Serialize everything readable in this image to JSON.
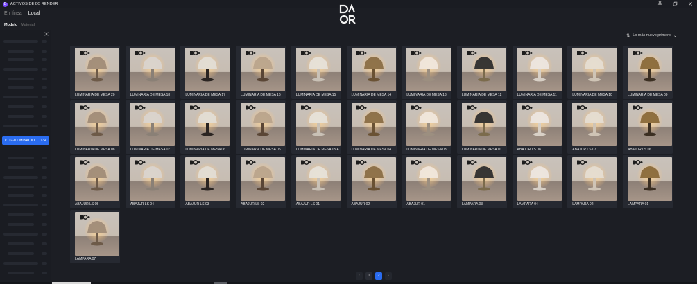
{
  "window": {
    "app_icon": "D",
    "title": "ACTIVOS DE D5 RENDER",
    "controls": [
      "pin-icon",
      "restore-icon",
      "close-icon"
    ]
  },
  "mode_tabs": [
    {
      "label": "En línea",
      "active": false
    },
    {
      "label": "Local",
      "active": true
    }
  ],
  "sub_tabs": [
    {
      "label": "Modelo",
      "active": true
    },
    {
      "label": "Material",
      "active": false
    }
  ],
  "sidebar": {
    "active_item": {
      "label": "07-ILUMINACIO...",
      "count": "134"
    }
  },
  "sort": {
    "label": "Lo más nuevo primero"
  },
  "colors": {
    "accent": "#2a6cf0",
    "background": "#1c1e24",
    "card": "#262931"
  },
  "assets": [
    {
      "label": "LUMINARIA DE MESA 20"
    },
    {
      "label": "LUMINARIA DE MESA 18"
    },
    {
      "label": "LUMINARIA DE MESA 17"
    },
    {
      "label": "LUMINARIA DE MESA 16"
    },
    {
      "label": "LUMINARIA DE MESA 15"
    },
    {
      "label": "LUMINARIA DE MESA 14"
    },
    {
      "label": "LUMINARIA DE MESA 13"
    },
    {
      "label": "LUMINARIA DE MESA 12"
    },
    {
      "label": "LUMINARIA DE MESA 11"
    },
    {
      "label": "LUMINARIA DE MESA 10"
    },
    {
      "label": "LUMINARIA DE MESA 09"
    },
    {
      "label": "LUMINARIA DE MESA 08"
    },
    {
      "label": "LUMINARIA DE MESA 07"
    },
    {
      "label": "LUMINARIA DE MESA 06"
    },
    {
      "label": "LUMINARIA DE MESA 05"
    },
    {
      "label": "LUMINARIA DE MESA 05 A"
    },
    {
      "label": "LUMINARIA DE MESA 04"
    },
    {
      "label": "LUMINARIA DE MESA 03"
    },
    {
      "label": "LUMINARIA DE MESA 01"
    },
    {
      "label": "ABAJUR LS 08"
    },
    {
      "label": "ABAJUR LS 07"
    },
    {
      "label": "ABAJUR LS 06"
    },
    {
      "label": "ABAJUR LS 05"
    },
    {
      "label": "ABAJUR LS 04"
    },
    {
      "label": "ABAJUR LS 03"
    },
    {
      "label": "ABAJUR LS 02"
    },
    {
      "label": "ABAJUR LS 01"
    },
    {
      "label": "ABAJUR 02"
    },
    {
      "label": "ABAJUR 01"
    },
    {
      "label": "LAMPARA 03"
    },
    {
      "label": "LAMPARA 04"
    },
    {
      "label": "LAMPARA 02"
    },
    {
      "label": "LAMPARA 01"
    },
    {
      "label": "LAMPARA  07"
    }
  ],
  "pagination": {
    "prev": "‹",
    "pages": [
      {
        "label": "1",
        "active": false
      },
      {
        "label": "2",
        "active": true
      }
    ],
    "next": "›"
  }
}
